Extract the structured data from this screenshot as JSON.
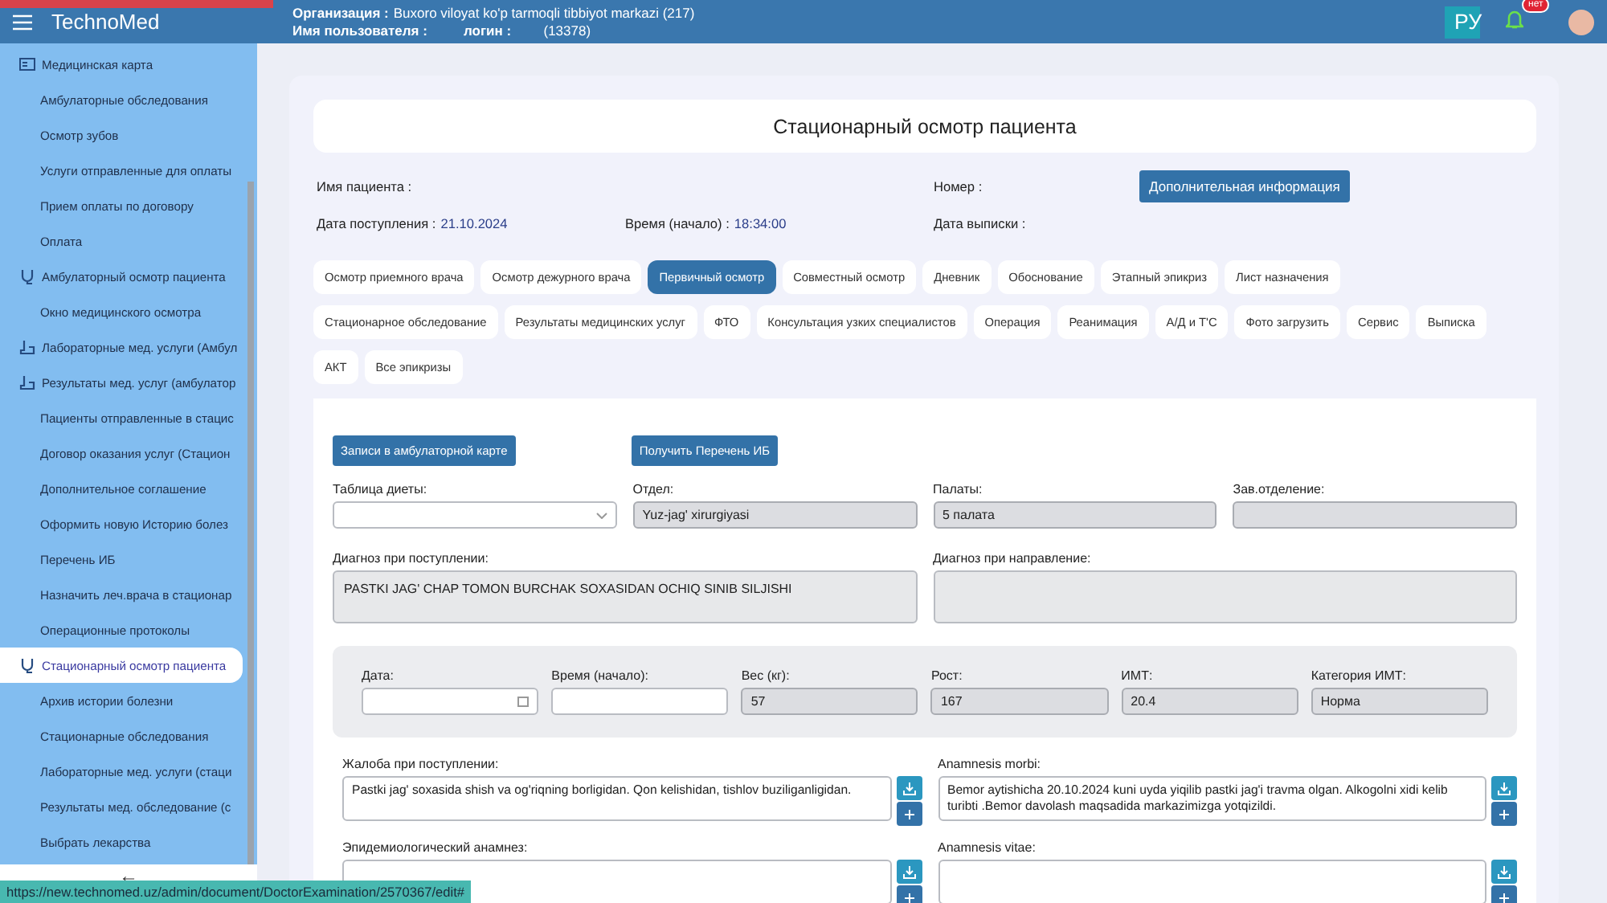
{
  "topbar": {
    "app_name": "TechnoMed",
    "organization_label": "Организация :",
    "organization": "Buxoro viloyat ko'p tarmoqli tibbiyot markazi (217)",
    "user_label": "Имя пользователя :",
    "login_label": "логин :",
    "login_id": "(13378)",
    "language": "РУ",
    "notification_badge": "нет"
  },
  "sidebar": {
    "items": [
      {
        "label": "Медицинская карта",
        "kind": "record",
        "selected": false
      },
      {
        "label": "Амбулаторные обследования",
        "kind": "link",
        "selected": false
      },
      {
        "label": "Осмотр зубов",
        "kind": "link",
        "selected": false
      },
      {
        "label": "Услуги отправленные для оплаты",
        "kind": "link",
        "selected": false
      },
      {
        "label": "Прием оплаты по договору",
        "kind": "link",
        "selected": false
      },
      {
        "label": "Оплата",
        "kind": "link",
        "selected": false
      },
      {
        "label": "Амбулаторный осмотр пациента",
        "kind": "exam",
        "selected": false
      },
      {
        "label": "Окно медицинского осмотра",
        "kind": "link",
        "selected": false
      },
      {
        "label": "Лабораторные мед. услуги (Амбул",
        "kind": "lab",
        "selected": false
      },
      {
        "label": "Результаты мед. услуг (амбулатор",
        "kind": "lab",
        "selected": false
      },
      {
        "label": "Пациенты отправленные в стацис",
        "kind": "link",
        "selected": false
      },
      {
        "label": "Договор оказания услуг (Стацион",
        "kind": "link",
        "selected": false
      },
      {
        "label": "Дополнительное соглашение",
        "kind": "link",
        "selected": false
      },
      {
        "label": "Оформить новую Историю болез",
        "kind": "link",
        "selected": false
      },
      {
        "label": "Перечень ИБ",
        "kind": "link",
        "selected": false
      },
      {
        "label": "Назначить леч.врача в стационар",
        "kind": "link",
        "selected": false
      },
      {
        "label": "Операционные протоколы",
        "kind": "link",
        "selected": false
      },
      {
        "label": "Стационарный осмотр пациента",
        "kind": "exam",
        "selected": true
      },
      {
        "label": "Архив истории болезни",
        "kind": "link",
        "selected": false
      },
      {
        "label": "Стационарные обследования",
        "kind": "link",
        "selected": false
      },
      {
        "label": "Лабораторные мед. услуги (стаци",
        "kind": "link",
        "selected": false
      },
      {
        "label": "Результаты мед. обследование (с",
        "kind": "link",
        "selected": false
      },
      {
        "label": "Выбрать лекарства",
        "kind": "link",
        "selected": false
      }
    ],
    "collapse_arrow": "←"
  },
  "page": {
    "title": "Стационарный осмотр пациента",
    "patient_info": [
      {
        "label": "Имя пациента :"
      },
      {
        "label": "Номер :"
      },
      {
        "label": "Дата поступления :",
        "value": "21.10.2024"
      },
      {
        "label": "Время (начало) :",
        "value": "18:34:00"
      },
      {
        "label": "Дата выписки :"
      }
    ],
    "info_button": "Дополнительная информация",
    "tabs": [
      {
        "label": "Осмотр приемного врача",
        "selected": false
      },
      {
        "label": "Осмотр дежурного врача",
        "selected": false
      },
      {
        "label": "Первичный осмотр",
        "selected": true
      },
      {
        "label": "Совместный осмотр",
        "selected": false
      },
      {
        "label": "Дневник",
        "selected": false
      },
      {
        "label": "Обоснование",
        "selected": false
      },
      {
        "label": "Этапный эпикриз",
        "selected": false
      },
      {
        "label": "Лист назначения",
        "selected": false
      },
      {
        "label": "Стационарное обследование",
        "selected": false
      },
      {
        "label": "Результаты медицинских услуг",
        "selected": false
      },
      {
        "label": "ФТО",
        "selected": false
      },
      {
        "label": "Консультация узких специалистов",
        "selected": false
      },
      {
        "label": "Операция",
        "selected": false
      },
      {
        "label": "Реанимация",
        "selected": false
      },
      {
        "label": "А/Д и Т'С",
        "selected": false
      },
      {
        "label": "Фото загрузить",
        "selected": false
      },
      {
        "label": "Сервис",
        "selected": false
      },
      {
        "label": "Выписка",
        "selected": false
      },
      {
        "label": "АКТ",
        "selected": false
      },
      {
        "label": "Все эпикризы",
        "selected": false
      }
    ],
    "action_buttons": [
      "Записи в амбулаторной карте",
      "Получить Перечень ИБ"
    ],
    "fields": [
      {
        "label": "Таблица диеты:",
        "kind": "select",
        "readonly": false
      },
      {
        "label": "Отдел:",
        "value": "Yuz-jag' xirurgiyasi",
        "kind": "text",
        "readonly": true
      },
      {
        "label": "Палаты:",
        "value": "5 палата",
        "kind": "text",
        "readonly": true
      },
      {
        "label": "Зав.отделение:",
        "kind": "text",
        "readonly": true
      }
    ],
    "diagnoses": [
      {
        "label": "Диагноз при поступлении:",
        "value": "PASTKI JAG' CHAP TOMON BURCHAK SOXASIDAN  OCHIQ  SINIB SILJISHI"
      },
      {
        "label": "Диагноз при направление:"
      }
    ],
    "measurements": [
      {
        "label": "Дата:",
        "kind": "date",
        "readonly": false
      },
      {
        "label": "Время (начало):",
        "kind": "text",
        "readonly": false
      },
      {
        "label": "Вес (кг):",
        "value": "57",
        "kind": "text",
        "readonly": true
      },
      {
        "label": "Рост:",
        "value": "167",
        "kind": "text",
        "readonly": true
      },
      {
        "label": "ИМТ:",
        "value": "20.4",
        "kind": "text",
        "readonly": true
      },
      {
        "label": "Категория ИМТ:",
        "value": "Норма",
        "kind": "text",
        "readonly": true
      }
    ],
    "notes": [
      {
        "label": "Жалоба при поступлении:",
        "value": "Pastki jag' soxasida shish va og'riqning borligidan. Qon kelishidan, tishlov buziliganligidan."
      },
      {
        "label": "Anamnesis morbi:",
        "value": "Bemor aytishicha 20.10.2024 kuni uyda yiqilib  pastki jag'i travma olgan.  Alkogolni xidi kelib turibti .Bemor davolash maqsadida markazimizga yotqizildi."
      },
      {
        "label": "Эпидемиологический анамнез:"
      },
      {
        "label": "Anamnesis vitae:"
      }
    ]
  },
  "status_url": "https://new.technomed.uz/admin/document/DoctorExamination/2570367/edit#"
}
